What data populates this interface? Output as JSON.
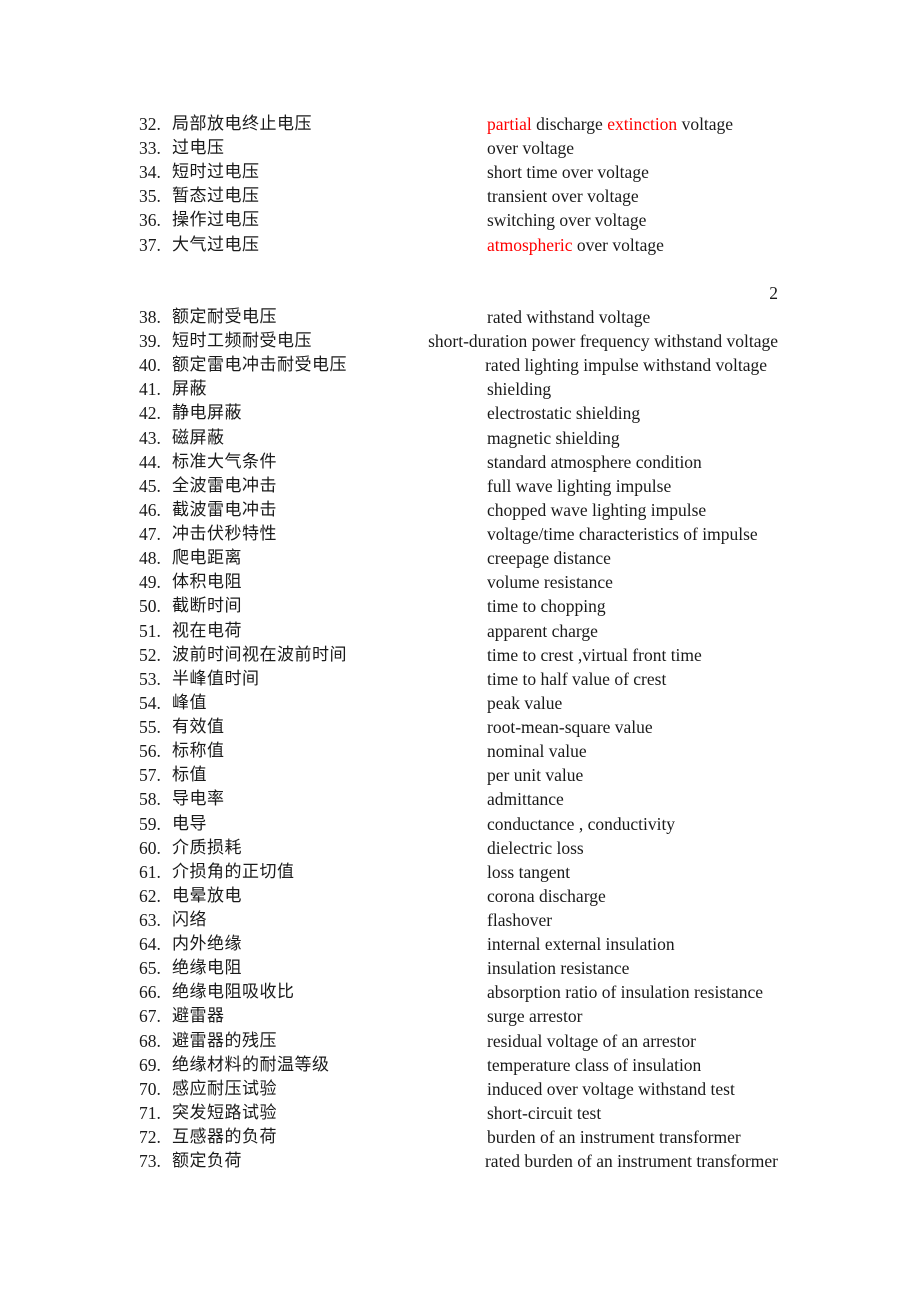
{
  "colors": {
    "text": "#1a1a1a",
    "highlight": "#ff0000"
  },
  "page_number": "2",
  "section1": [
    {
      "num": "32.",
      "zh": "局部放电终止电压",
      "en_parts": [
        {
          "t": "partial",
          "red": true
        },
        {
          "t": " discharge ",
          "red": false
        },
        {
          "t": "extinction",
          "red": true
        },
        {
          "t": " voltage",
          "red": false
        }
      ]
    },
    {
      "num": "33.",
      "zh": "过电压",
      "en": "over voltage"
    },
    {
      "num": "34.",
      "zh": "短时过电压",
      "en": "short time over voltage"
    },
    {
      "num": "35.",
      "zh": "暂态过电压",
      "en": "transient over voltage"
    },
    {
      "num": "36.",
      "zh": "操作过电压",
      "en": "switching over voltage"
    },
    {
      "num": "37.",
      "zh": "大气过电压",
      "en_parts": [
        {
          "t": "atmospheric",
          "red": true
        },
        {
          "t": " over voltage",
          "red": false
        }
      ]
    }
  ],
  "section2": [
    {
      "num": "38.",
      "zh": "额定耐受电压",
      "en": "rated withstand voltage"
    },
    {
      "num": "39.",
      "zh": "短时工频耐受电压",
      "en": "short-duration power frequency withstand voltage",
      "align": "right"
    },
    {
      "num": "40.",
      "zh": "额定雷电冲击耐受电压",
      "en": "rated lighting impulse withstand voltage",
      "align": "right2"
    },
    {
      "num": "41.",
      "zh": "屏蔽",
      "en": "shielding"
    },
    {
      "num": "42.",
      "zh": "静电屏蔽",
      "en": "electrostatic shielding"
    },
    {
      "num": "43.",
      "zh": "磁屏蔽",
      "en": "magnetic shielding"
    },
    {
      "num": "44.",
      "zh": "标准大气条件",
      "en": "standard atmosphere condition"
    },
    {
      "num": "45.",
      "zh": "全波雷电冲击",
      "en": "full wave lighting impulse"
    },
    {
      "num": "46.",
      "zh": "截波雷电冲击",
      "en": "chopped wave lighting impulse"
    },
    {
      "num": "47.",
      "zh": "冲击伏秒特性",
      "en": "voltage/time characteristics of impulse"
    },
    {
      "num": "48.",
      "zh": "爬电距离",
      "en": "creepage distance"
    },
    {
      "num": "49.",
      "zh": "体积电阻",
      "en": "volume resistance"
    },
    {
      "num": "50.",
      "zh": "截断时间",
      "en": "time to chopping"
    },
    {
      "num": "51.",
      "zh": "视在电荷",
      "en": "apparent charge"
    },
    {
      "num": "52.",
      "zh": "波前时间视在波前时间",
      "en": "time to crest ,virtual front time"
    },
    {
      "num": "53.",
      "zh": "半峰值时间",
      "en": "time to half value of crest"
    },
    {
      "num": "54.",
      "zh": "峰值",
      "en": "peak value"
    },
    {
      "num": "55.",
      "zh": "有效值",
      "en": "root-mean-square value"
    },
    {
      "num": "56.",
      "zh": "标称值",
      "en": "nominal value"
    },
    {
      "num": "57.",
      "zh": "标值",
      "en": "per unit value"
    },
    {
      "num": "58.",
      "zh": "导电率",
      "en": "admittance"
    },
    {
      "num": "59.",
      "zh": "电导",
      "en": "conductance , conductivity"
    },
    {
      "num": "60.",
      "zh": "介质损耗",
      "en": "dielectric loss"
    },
    {
      "num": "61.",
      "zh": "介损角的正切值",
      "en": "loss tangent"
    },
    {
      "num": "62.",
      "zh": "电晕放电",
      "en": "corona discharge"
    },
    {
      "num": "63.",
      "zh": "闪络",
      "en": "flashover"
    },
    {
      "num": "64.",
      "zh": "内外绝缘",
      "en": "internal external insulation"
    },
    {
      "num": "65.",
      "zh": "绝缘电阻",
      "en": "insulation resistance"
    },
    {
      "num": "66.",
      "zh": "绝缘电阻吸收比",
      "en": "absorption ratio of insulation resistance"
    },
    {
      "num": "67.",
      "zh": "避雷器",
      "en": "surge arrestor"
    },
    {
      "num": "68.",
      "zh": "避雷器的残压",
      "en": "residual voltage of an arrestor"
    },
    {
      "num": "69.",
      "zh": "绝缘材料的耐温等级",
      "en": "temperature class of insulation"
    },
    {
      "num": "70.",
      "zh": "感应耐压试验",
      "en": "induced over voltage withstand test"
    },
    {
      "num": "71.",
      "zh": "突发短路试验",
      "en": "short-circuit test"
    },
    {
      "num": "72.",
      "zh": "互感器的负荷",
      "en": "burden of an instrument transformer"
    },
    {
      "num": "73.",
      "zh": "额定负荷",
      "en": "rated burden of an instrument transformer",
      "align": "right"
    }
  ]
}
